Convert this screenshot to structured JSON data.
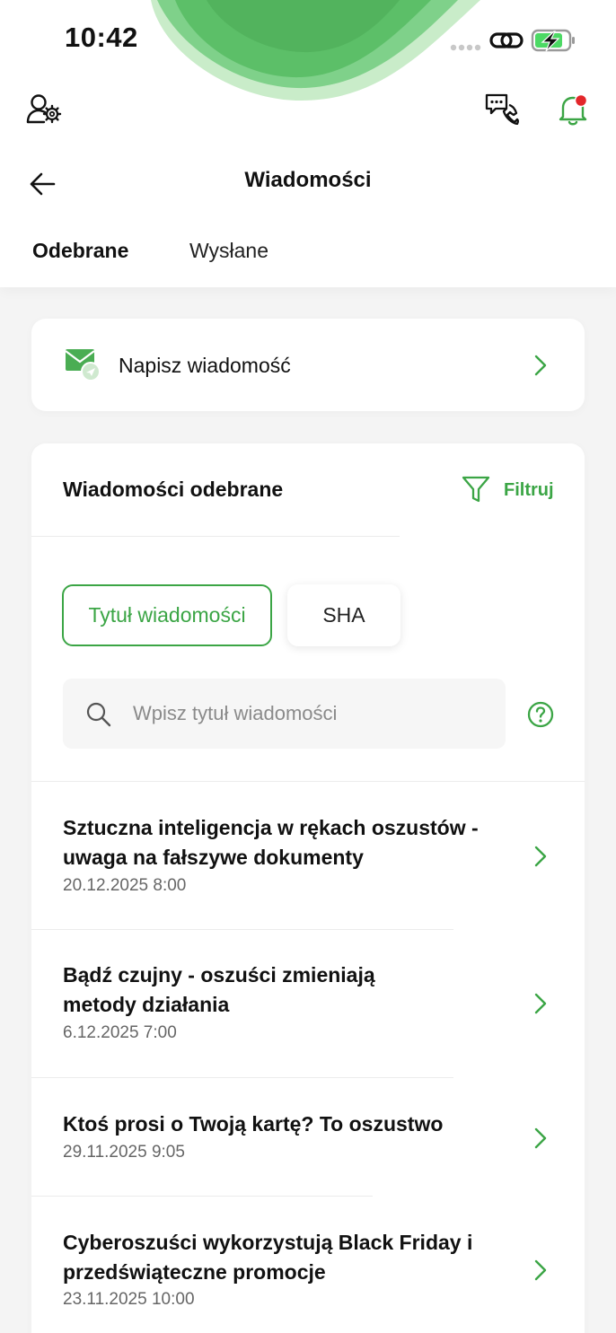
{
  "status_bar": {
    "time": "10:42",
    "icons": [
      "signal-icon",
      "link-icon",
      "battery-charging-icon"
    ]
  },
  "header": {
    "icons": [
      "user-settings-icon",
      "support-chat-icon",
      "notification-bell-icon"
    ],
    "title": "Wiadomości",
    "back_icon": "arrow-left-icon"
  },
  "tabs": [
    {
      "label": "Odebrane",
      "active": true
    },
    {
      "label": "Wysłane",
      "active": false
    }
  ],
  "compose": {
    "label": "Napisz wiadomość",
    "icon": "envelope-icon"
  },
  "inbox": {
    "title": "Wiadomości odebrane",
    "filter_label": "Filtruj",
    "search_modes": [
      {
        "label": "Tytuł wiadomości",
        "active": true
      },
      {
        "label": "SHA",
        "active": false
      }
    ],
    "search_placeholder": "Wpisz tytuł wiadomości",
    "messages": [
      {
        "title": "Sztuczna inteligencja w rękach oszustów - uwaga na fałszywe dokumenty",
        "date": "20.12.2025 8:00"
      },
      {
        "title": "Bądź czujny - oszuści zmieniają metody działania",
        "date": "6.12.2025 7:00"
      },
      {
        "title": "Ktoś prosi o Twoją kartę? To oszustwo",
        "date": "29.11.2025 9:05"
      },
      {
        "title": "Cyberoszuści wykorzystują Black Friday i przedświąteczne promocje",
        "date": "23.11.2025 10:00"
      }
    ]
  },
  "colors": {
    "accent": "#3ba545",
    "notification_dot": "#e3262a",
    "background": "#f4f4f4",
    "card": "#ffffff"
  }
}
